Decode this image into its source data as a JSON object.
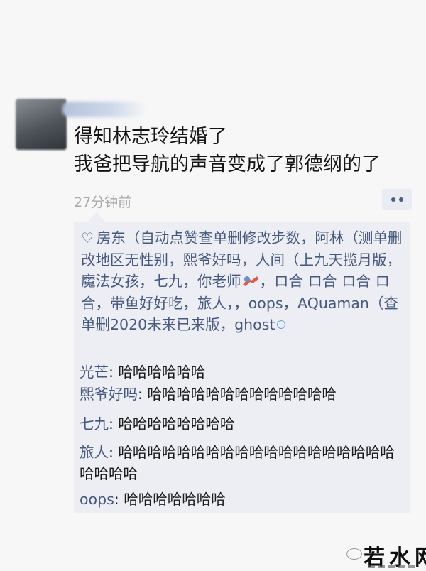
{
  "post": {
    "line1": "得知林志玲结婚了",
    "line2": "我爸把导航的声音变成了郭德纲的了",
    "time": "27分钟前"
  },
  "likes": {
    "part1": "房东（自动点赞查单删修改步数，阿林（测单删改地区无性别，熙爷好吗，人间（上九天揽月版，魔法女孩，七九，你老师",
    "part2": "，ロ合 ロ合 ロ合 ロ合，带鱼好好吃，旅人，，oops，AQuaman（查单删2020未来已来版，ghost"
  },
  "comments": [
    {
      "name": "光芒",
      "sep": ": ",
      "text": "哈哈哈哈哈哈"
    },
    {
      "name": "熙爷好吗",
      "sep": ": ",
      "text": "哈哈哈哈哈哈哈哈哈哈哈哈哈"
    },
    {
      "name": "七九",
      "sep": ": ",
      "text": "哈哈哈哈哈哈哈哈"
    },
    {
      "name": "旅人",
      "sep": ": ",
      "text": "哈哈哈哈哈哈哈哈哈哈哈哈哈哈哈哈哈哈哈哈哈哈哈"
    },
    {
      "name": "oops",
      "sep": ": ",
      "text": "哈哈哈哈哈哈哈"
    }
  ],
  "watermark": "若水网",
  "colors": {
    "link": "#46597f",
    "panel": "#eceef3",
    "time": "#a8a8a8"
  }
}
